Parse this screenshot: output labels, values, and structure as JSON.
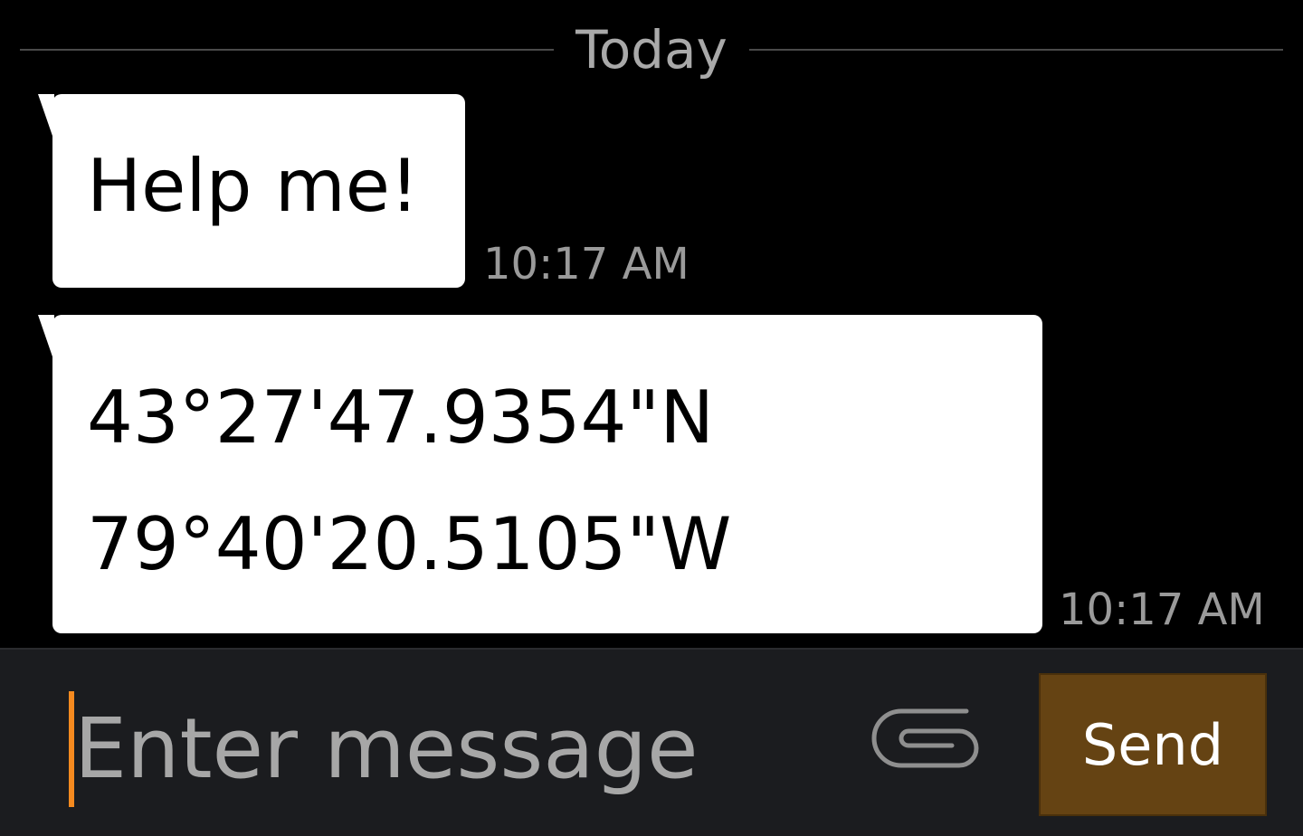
{
  "conversation": {
    "date_divider": "Today",
    "messages": [
      {
        "text": "Help me!",
        "time": "10:17 AM"
      },
      {
        "lines": [
          "43°27'47.9354\"N",
          "79°40'20.5105\"W"
        ],
        "time": "10:17 AM"
      }
    ]
  },
  "composer": {
    "placeholder": "Enter message",
    "value": "",
    "attach_icon": "paperclip-icon",
    "send_label": "Send",
    "caret_color": "#f58a1f",
    "send_button_color": "#654313"
  }
}
